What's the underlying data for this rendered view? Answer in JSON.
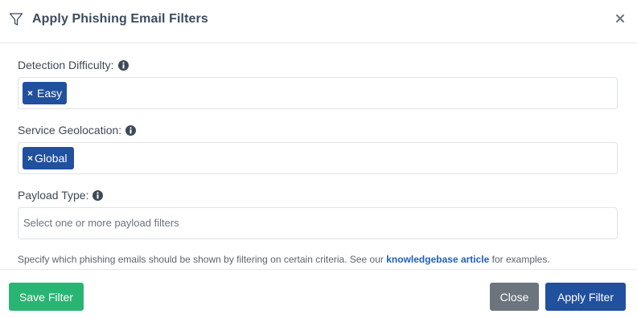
{
  "header": {
    "title": "Apply Phishing Email Filters",
    "icon": "filter-icon",
    "close_icon": "close-icon"
  },
  "fields": [
    {
      "label": "Detection Difficulty:",
      "tags": [
        {
          "label": "Easy"
        }
      ],
      "placeholder": ""
    },
    {
      "label": "Service Geolocation:",
      "tags": [
        {
          "label": "Global"
        }
      ],
      "placeholder": ""
    },
    {
      "label": "Payload Type:",
      "tags": [],
      "placeholder": "Select one or more payload filters"
    }
  ],
  "tag_remove_glyph": "×",
  "help": {
    "prefix": "Specify which phishing emails should be shown by filtering on certain criteria. See our ",
    "link": "knowledgebase article",
    "suffix": " for examples."
  },
  "footer": {
    "save_label": "Save Filter",
    "close_label": "Close",
    "apply_label": "Apply Filter"
  },
  "colors": {
    "tag": "#20509e",
    "save": "#28b573",
    "close": "#6c757d",
    "apply": "#20509e",
    "link": "#1f5fbf"
  }
}
